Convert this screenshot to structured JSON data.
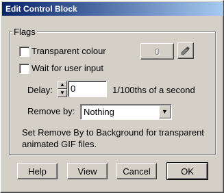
{
  "window": {
    "title": "Edit Control Block"
  },
  "flags": {
    "group_label": "Flags",
    "transparent_label": "Transparent colour",
    "transparent_checked": false,
    "colour_value": "0",
    "wait_label": "Wait for user input",
    "wait_checked": false,
    "delay_label": "Delay:",
    "delay_value": "0",
    "delay_unit": "1/100ths of a second",
    "remove_label": "Remove by:",
    "remove_value": "Nothing",
    "note": "Set Remove By to Background for transparent animated GIF files."
  },
  "buttons": {
    "help": "Help",
    "view": "View",
    "cancel": "Cancel",
    "ok": "OK"
  },
  "icons": {
    "picker": "eyedropper-icon",
    "spin_up": "up-arrow-icon",
    "spin_down": "down-arrow-icon",
    "dropdown": "chevron-down-icon"
  }
}
